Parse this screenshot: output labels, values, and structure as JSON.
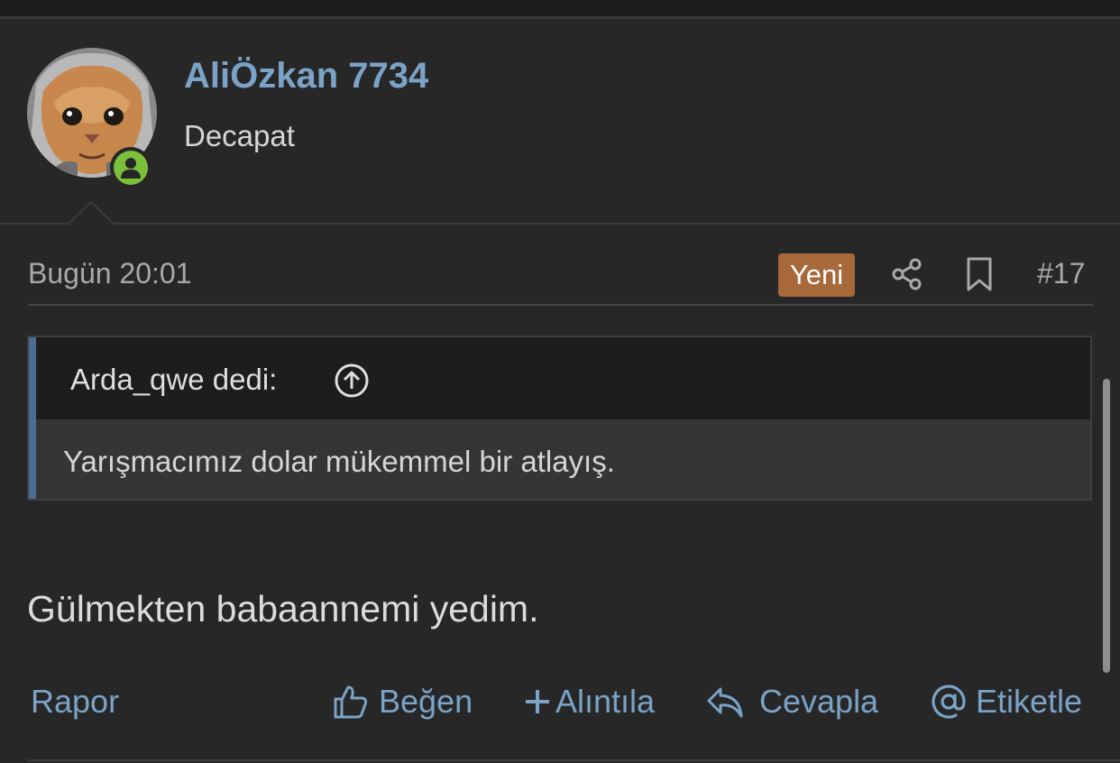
{
  "author": {
    "name": "AliÖzkan 7734",
    "title": "Decapat",
    "online": true
  },
  "post": {
    "date": "Bugün 20:01",
    "badge": "Yeni",
    "number": "#17",
    "body": "Gülmekten babaannemi yedim."
  },
  "quote": {
    "author": "Arda_qwe dedi:",
    "text": "Yarışmacımız dolar mükemmel bir atlayış."
  },
  "actions": {
    "report": "Rapor",
    "like": "Beğen",
    "quote": "Alıntıla",
    "reply": "Cevapla",
    "mention": "Etiketle"
  },
  "icons": {
    "share": "share-icon",
    "bookmark": "bookmark-icon",
    "quote_jump": "arrow-up-circle-icon",
    "like": "thumbs-up-icon",
    "add_quote": "plus-icon",
    "reply": "reply-arrow-icon",
    "mention": "at-sign-icon",
    "online": "user-icon"
  },
  "colors": {
    "background": "#272727",
    "link": "#7aa3c7",
    "badge": "#a7693a",
    "online": "#7bbf3a",
    "quote_bar": "#4c6b92"
  }
}
